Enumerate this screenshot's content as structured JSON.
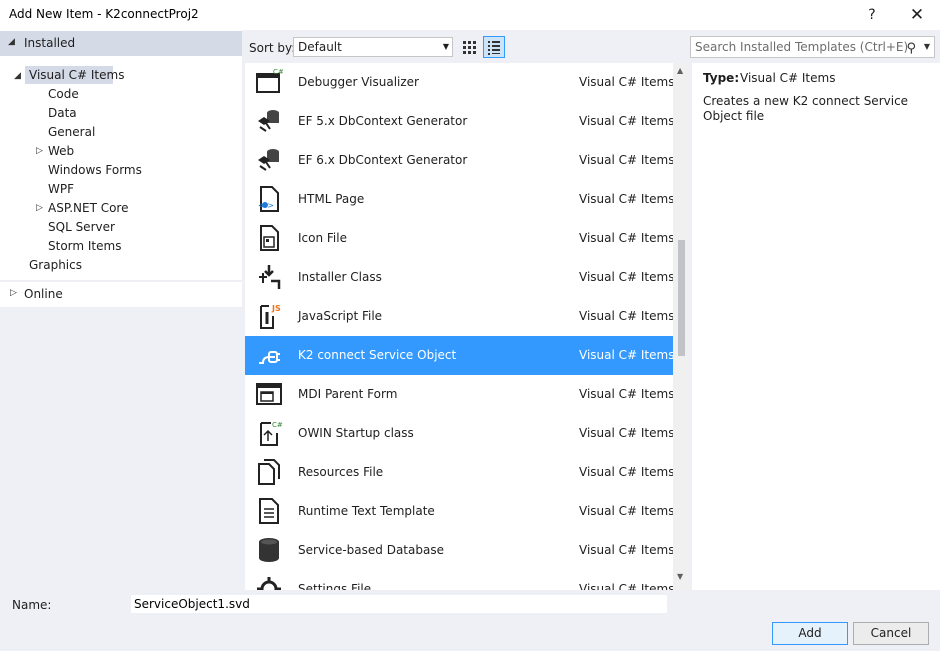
{
  "window": {
    "title": "Add New Item - K2connectProj2",
    "help_label": "?",
    "close_label": "✕"
  },
  "tree": {
    "installed_label": "Installed",
    "root_label": "Visual C# Items",
    "children": [
      "Code",
      "Data",
      "General",
      "Web",
      "Windows Forms",
      "WPF",
      "ASP.NET Core",
      "SQL Server",
      "Storm Items"
    ],
    "graphics_label": "Graphics",
    "online_label": "Online"
  },
  "toolbar": {
    "sort_label": "Sort by:",
    "sort_value": "Default",
    "search_placeholder": "Search Installed Templates (Ctrl+E)"
  },
  "items": [
    {
      "name": "Debugger Visualizer",
      "lang": "Visual C# Items",
      "icon": "debugger-visualizer-icon"
    },
    {
      "name": "EF 5.x DbContext Generator",
      "lang": "Visual C# Items",
      "icon": "ef-generator-icon"
    },
    {
      "name": "EF 6.x DbContext Generator",
      "lang": "Visual C# Items",
      "icon": "ef-generator-icon"
    },
    {
      "name": "HTML Page",
      "lang": "Visual C# Items",
      "icon": "html-page-icon"
    },
    {
      "name": "Icon File",
      "lang": "Visual C# Items",
      "icon": "icon-file-icon"
    },
    {
      "name": "Installer Class",
      "lang": "Visual C# Items",
      "icon": "installer-class-icon"
    },
    {
      "name": "JavaScript File",
      "lang": "Visual C# Items",
      "icon": "javascript-file-icon"
    },
    {
      "name": "K2 connect Service Object",
      "lang": "Visual C# Items",
      "icon": "k2-service-object-icon"
    },
    {
      "name": "MDI Parent Form",
      "lang": "Visual C# Items",
      "icon": "mdi-form-icon"
    },
    {
      "name": "OWIN Startup class",
      "lang": "Visual C# Items",
      "icon": "owin-startup-icon"
    },
    {
      "name": "Resources File",
      "lang": "Visual C# Items",
      "icon": "resources-file-icon"
    },
    {
      "name": "Runtime Text Template",
      "lang": "Visual C# Items",
      "icon": "text-template-icon"
    },
    {
      "name": "Service-based Database",
      "lang": "Visual C# Items",
      "icon": "database-icon"
    },
    {
      "name": "Settings File",
      "lang": "Visual C# Items",
      "icon": "settings-file-icon"
    }
  ],
  "details": {
    "type_label": "Type:",
    "type_value": "Visual C# Items",
    "description": "Creates a new K2 connect Service Object file"
  },
  "bottom": {
    "name_label": "Name:",
    "name_value": "ServiceObject1.svd",
    "add_label": "Add",
    "cancel_label": "Cancel"
  },
  "colors": {
    "selection": "#3399ff",
    "tree_header": "#d4dae6",
    "dialog_bg": "#eef0f5"
  }
}
